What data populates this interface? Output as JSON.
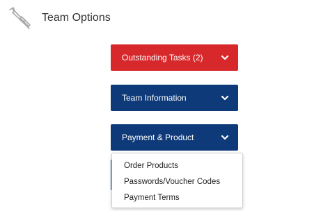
{
  "header": {
    "title": "Team Options",
    "icon": "wrench-screwdriver-icon"
  },
  "buttons": {
    "outstanding": {
      "label": "Outstanding Tasks (2)",
      "color": "#d7282c"
    },
    "team_info": {
      "label": "Team Information",
      "color": "#0e3a79"
    },
    "payment": {
      "label": "Payment & Product",
      "color": "#0e3a79"
    }
  },
  "payment_menu": {
    "items": [
      {
        "label": "Order Products"
      },
      {
        "label": "Passwords/Voucher Codes"
      },
      {
        "label": "Payment Terms"
      }
    ]
  }
}
